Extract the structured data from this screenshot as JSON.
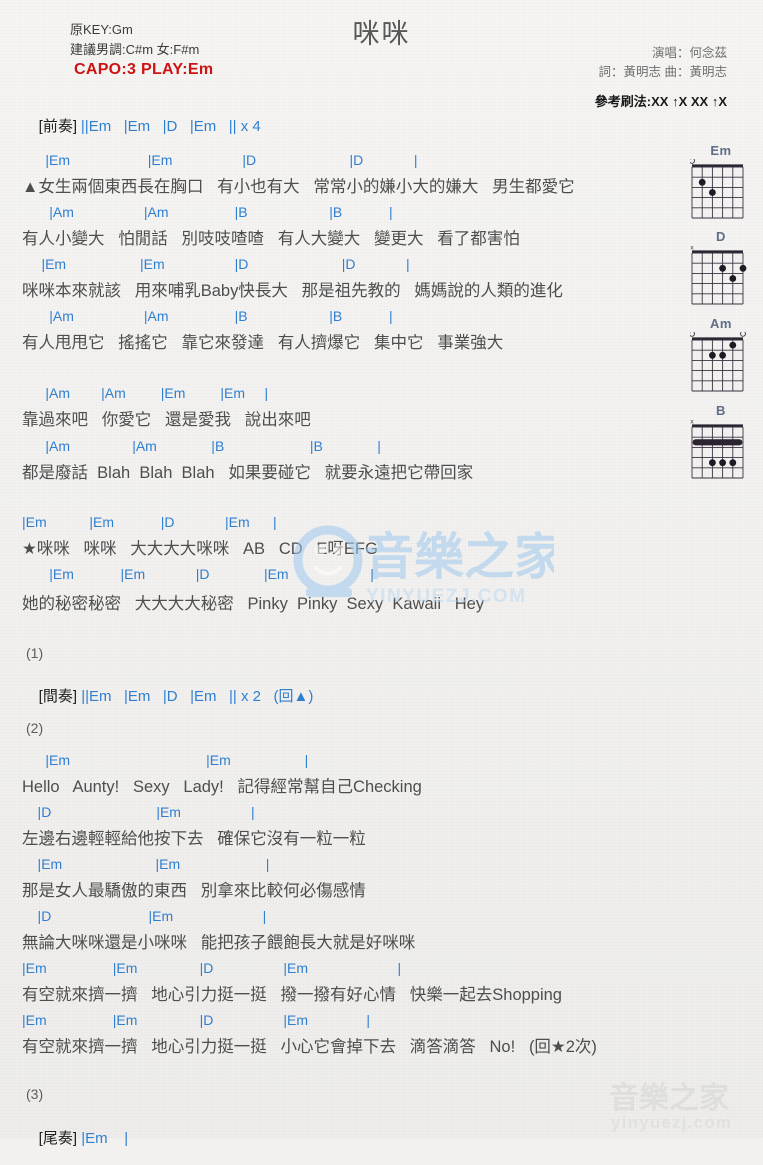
{
  "header": {
    "title": "咪咪",
    "orig_key": "原KEY:Gm",
    "suggest_key": "建議男調:C#m 女:F#m",
    "capo": "CAPO:3 PLAY:Em",
    "singer": "演唱：何念茲",
    "writer": "詞：黃明志  曲：黃明志",
    "strum": "參考刷法:XX ↑X XX ↑X",
    "accent_blue": "#2f7fd1",
    "accent_red": "#cc1414"
  },
  "intro": {
    "tag": "[前奏]",
    "bars": "||Em   |Em   |D   |Em   || x 4"
  },
  "sections": [
    {
      "name": "verse-1",
      "lines": [
        {
          "chords": "      |Em                    |Em                  |D                        |D             |",
          "lyrics": "▲女生兩個東西長在胸口   有小也有大   常常小的嫌小大的嫌大   男生都愛它"
        },
        {
          "chords": "       |Am                  |Am                 |B                     |B            |",
          "lyrics": "有人小變大   怕閒話   別吱吱喳喳   有人大變大   變更大   看了都害怕"
        }
      ]
    },
    {
      "name": "verse-2",
      "lines": [
        {
          "chords": "     |Em                   |Em                  |D                        |D             |",
          "lyrics": "咪咪本來就該   用來哺乳Baby快長大   那是祖先教的   媽媽說的人類的進化"
        },
        {
          "chords": "       |Am                  |Am                 |B                     |B            |",
          "lyrics": "有人甩甩它   搖搖它   靠它來發達   有人擠爆它   集中它   事業強大"
        }
      ]
    },
    {
      "name": "verse-3",
      "lines": [
        {
          "chords": "      |Am        |Am         |Em         |Em     |",
          "lyrics": "靠過來吧   你愛它   還是愛我   說出來吧"
        },
        {
          "chords": "      |Am                |Am              |B                      |B              |",
          "lyrics": "都是廢話  Blah  Blah  Blah   如果要碰它   就要永遠把它帶回家"
        }
      ]
    },
    {
      "name": "chorus",
      "lines": [
        {
          "chords": "|Em           |Em            |D             |Em      |",
          "lyrics": "★咪咪   咪咪   大大大大咪咪   AB   CD   E呀EFG"
        },
        {
          "chords": "       |Em            |Em             |D              |Em                     |",
          "lyrics": "她的秘密秘密   大大大大秘密   Pinky  Pinky  Sexy  Kawaii   Hey"
        }
      ]
    }
  ],
  "marker_1": "(1)",
  "interlude": {
    "tag": "[間奏]",
    "bars": "||Em   |Em   |D   |Em   || x 2   (回▲)"
  },
  "marker_2": "(2)",
  "verse2_block": {
    "lines": [
      {
        "chords": "      |Em                                   |Em                   |",
        "lyrics": "Hello   Aunty!   Sexy   Lady!   記得經常幫自己Checking"
      },
      {
        "chords": "    |D                           |Em                  |",
        "lyrics": "左邊右邊輕輕給他按下去   確保它沒有一粒一粒"
      },
      {
        "chords": "    |Em                        |Em                      |",
        "lyrics": "那是女人最驕傲的東西   別拿來比較何必傷感情"
      },
      {
        "chords": "    |D                         |Em                       |",
        "lyrics": "無論大咪咪還是小咪咪   能把孩子餵飽長大就是好咪咪"
      },
      {
        "chords": "|Em                 |Em                |D                  |Em                       |",
        "lyrics": "有空就來擠一擠   地心引力挺一挺   撥一撥有好心情   快樂一起去Shopping"
      },
      {
        "chords": "|Em                 |Em                |D                  |Em               |",
        "lyrics": "有空就來擠一擠   地心引力挺一挺   小心它會掉下去   滴答滴答   No!   (回★2次)"
      }
    ]
  },
  "marker_3": "(3)",
  "outro": {
    "tag": "[尾奏]",
    "bars": "|Em    |"
  },
  "chord_diagrams": [
    {
      "name": "Em",
      "markers": [
        {
          "sym": "o",
          "string": 0
        }
      ],
      "dots": [
        {
          "string": 1,
          "fret": 2
        },
        {
          "string": 2,
          "fret": 3
        }
      ],
      "barre": null
    },
    {
      "name": "D",
      "markers": [
        {
          "sym": "x",
          "string": 0
        }
      ],
      "dots": [
        {
          "string": 3,
          "fret": 2
        },
        {
          "string": 5,
          "fret": 2
        },
        {
          "string": 4,
          "fret": 3
        }
      ],
      "barre": null
    },
    {
      "name": "Am",
      "markers": [
        {
          "sym": "o",
          "string": 0
        },
        {
          "sym": "o",
          "string": 5
        }
      ],
      "dots": [
        {
          "string": 4,
          "fret": 1
        },
        {
          "string": 2,
          "fret": 2
        },
        {
          "string": 3,
          "fret": 2
        }
      ],
      "barre": null
    },
    {
      "name": "B",
      "markers": [
        {
          "sym": "x",
          "string": 0
        }
      ],
      "dots": [
        {
          "string": 2,
          "fret": 4
        },
        {
          "string": 3,
          "fret": 4
        },
        {
          "string": 4,
          "fret": 4
        }
      ],
      "barre": {
        "fret": 2
      }
    }
  ],
  "watermark": {
    "center_cn": "音樂之家",
    "center_url": "YINYUEZJ.COM",
    "bottom_cn": "音樂之家",
    "bottom_url": "yinyuezj.com"
  }
}
